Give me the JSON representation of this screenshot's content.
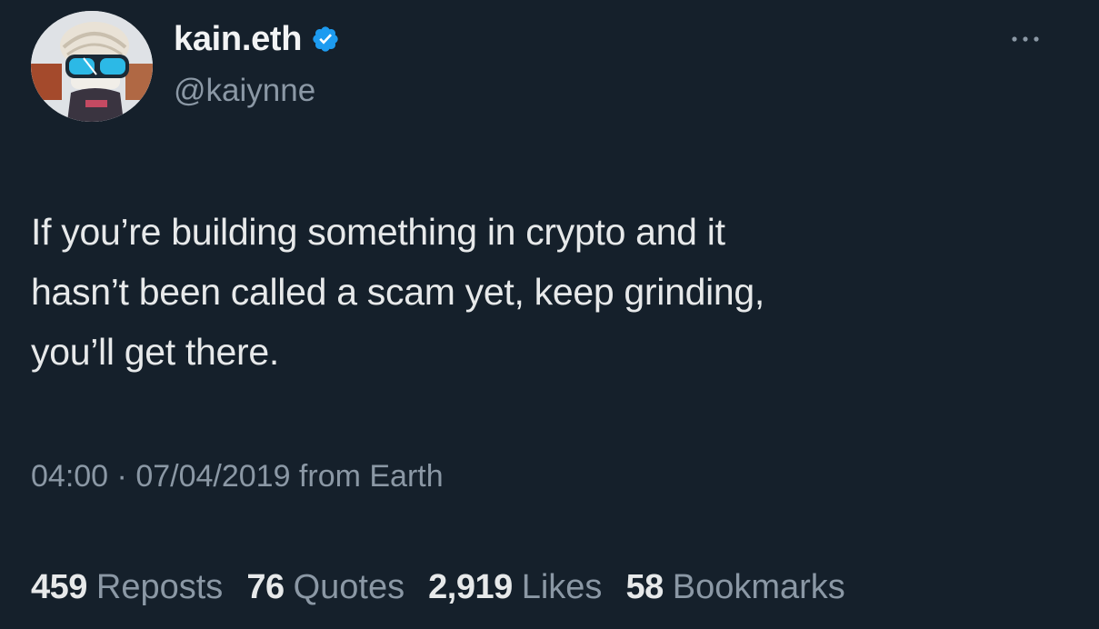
{
  "author": {
    "display_name": "kain.eth",
    "handle": "@kaiynne",
    "verified": true,
    "verified_color": "#1d9bf0"
  },
  "tweet": {
    "text": "If you’re building something in crypto and it\nhasn’t been called a scam yet, keep grinding,\nyou’ll get there.",
    "time": "04:00",
    "separator": " · ",
    "date": "07/04/2019",
    "source": " from Earth"
  },
  "stats": {
    "reposts": {
      "count": "459",
      "label": "Reposts"
    },
    "quotes": {
      "count": "76",
      "label": "Quotes"
    },
    "likes": {
      "count": "2,919",
      "label": "Likes"
    },
    "bookmarks": {
      "count": "58",
      "label": "Bookmarks"
    }
  },
  "theme": {
    "background": "#15202b",
    "text": "#e7e9ea",
    "secondary": "#8b98a5"
  },
  "icons": {
    "verified": "verified-badge-icon",
    "more": "more-options-icon"
  }
}
